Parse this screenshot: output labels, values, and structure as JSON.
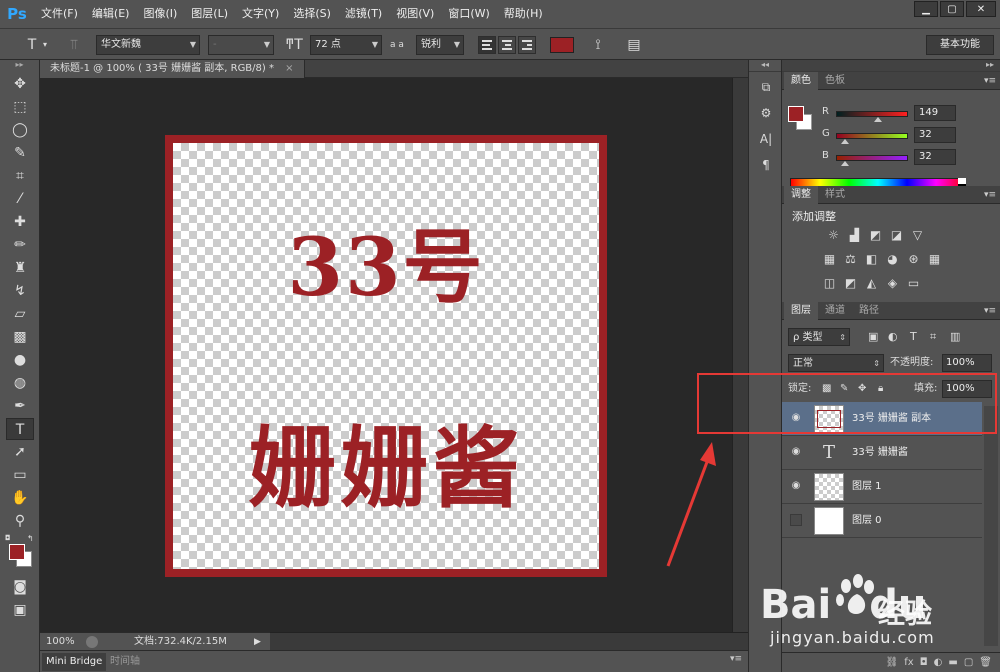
{
  "app": {
    "logo": "Ps",
    "menu": [
      "文件(F)",
      "编辑(E)",
      "图像(I)",
      "图层(L)",
      "文字(Y)",
      "选择(S)",
      "滤镜(T)",
      "视图(V)",
      "窗口(W)",
      "帮助(H)"
    ],
    "window_controls": [
      "▁",
      "▢",
      "✕"
    ]
  },
  "options": {
    "font_family": "华文新魏",
    "font_style": "-",
    "font_size": "72 点",
    "aa_label": "a a",
    "antialias": "锐利",
    "workspace": "基本功能",
    "text_color": "#9c2125"
  },
  "document": {
    "tab_title": "未标题-1 @ 100% ( 33号 姗姗酱 副本, RGB/8) *",
    "tab_close": "×",
    "line1": "33号",
    "line2": "姗姗酱",
    "zoom": "100%",
    "doc_info": "文档:732.4K/2.15M",
    "frame_color": "#9c2125"
  },
  "bottom_tabs": [
    "Mini Bridge",
    "时间轴"
  ],
  "color_panel": {
    "tabs": [
      "颜色",
      "色板"
    ],
    "fg_color": "#9c2125",
    "r_label": "R",
    "g_label": "G",
    "b_label": "B",
    "r": 149,
    "g": 32,
    "b": 32
  },
  "adjust_panel": {
    "tabs": [
      "调整",
      "样式"
    ],
    "title": "添加调整"
  },
  "layers_panel": {
    "tabs": [
      "图层",
      "通道",
      "路径"
    ],
    "kind_filter": "ρ 类型",
    "blend_mode": "正常",
    "opacity_label": "不透明度:",
    "opacity": "100%",
    "lock_label": "锁定:",
    "fill_label": "填充:",
    "fill": "100%",
    "layers": [
      {
        "name": "33号 姗姗酱 副本",
        "selected": true
      },
      {
        "name": "33号 姗姗酱",
        "selected": false
      },
      {
        "name": "图层 1",
        "selected": false
      },
      {
        "name": "图层 0",
        "selected": false
      }
    ]
  },
  "watermark": {
    "brand": "Bai",
    "brand2": "du",
    "product": "经验",
    "url": "jingyan.baidu.com"
  }
}
